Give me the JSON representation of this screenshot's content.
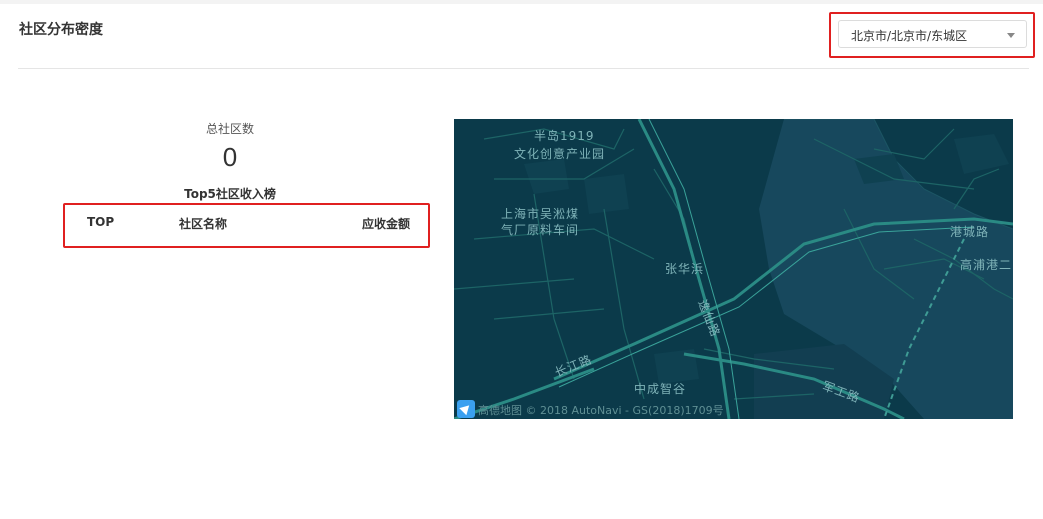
{
  "header": {
    "title": "社区分布密度",
    "region_select": {
      "value": "北京市/北京市/东城区"
    }
  },
  "stats": {
    "total_label": "总社区数",
    "total_value": "0",
    "ranking_title": "Top5社区收入榜",
    "columns": [
      "TOP",
      "社区名称",
      "应收金额"
    ],
    "rows": []
  },
  "map": {
    "labels": [
      "半岛1919",
      "文化创意产业园",
      "上海市吴淞煤",
      "气厂原料车间",
      "张华浜",
      "港城路",
      "高浦港二",
      "长江路",
      "中成智谷",
      "军工路",
      "逸仙路"
    ],
    "attribution": "高德地图 © 2018 AutoNavi - GS(2018)1709号"
  }
}
